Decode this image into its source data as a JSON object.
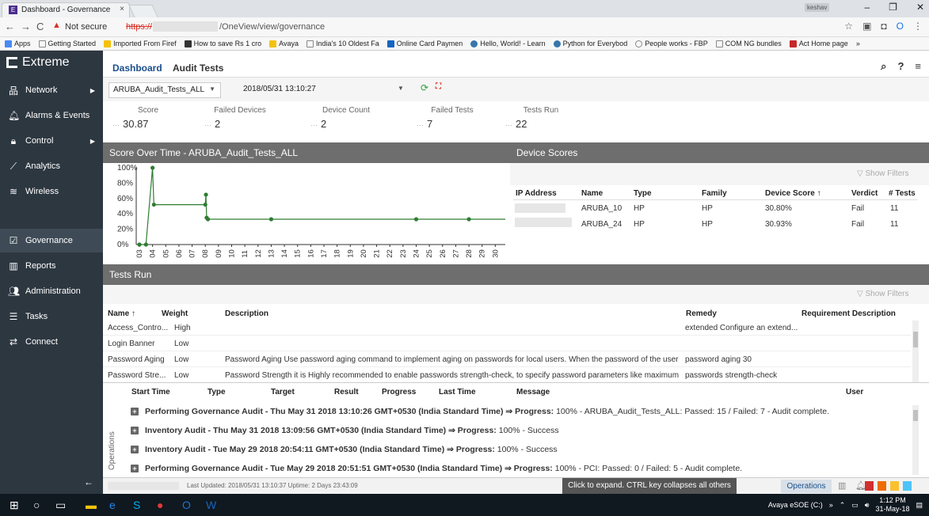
{
  "browser": {
    "tab_title": "Dashboard - Governance",
    "tab_close": "×",
    "not_secure": "Not secure",
    "https": "https://",
    "url_path": "/OneView/view/governance",
    "user_badge": "keshav",
    "bookmarks": [
      "Apps",
      "Getting Started",
      "Imported From Firef",
      "How to save Rs 1 cro",
      "Avaya",
      "India's 10 Oldest Fa",
      "Online Card Paymen",
      "Hello, World! - Learn",
      "Python for Everybod",
      "People works - FBP",
      "COM NG bundles",
      "Act Home page",
      "»"
    ]
  },
  "sidebar": {
    "brand": "Extreme",
    "items": [
      {
        "label": "Network",
        "icon": "network-icon"
      },
      {
        "label": "Alarms & Events",
        "icon": "bell-icon"
      },
      {
        "label": "Control",
        "icon": "lock-icon"
      },
      {
        "label": "Analytics",
        "icon": "chart-line-icon"
      },
      {
        "label": "Wireless",
        "icon": "wifi-icon"
      },
      {
        "label": "Governance",
        "icon": "check-square-icon"
      },
      {
        "label": "Reports",
        "icon": "bar-chart-icon"
      },
      {
        "label": "Administration",
        "icon": "users-icon"
      },
      {
        "label": "Tasks",
        "icon": "tasks-icon"
      },
      {
        "label": "Connect",
        "icon": "arrows-icon"
      }
    ]
  },
  "topnav": {
    "dashboard": "Dashboard",
    "audit_tests": "Audit Tests"
  },
  "selectors": {
    "test_suite": "ARUBA_Audit_Tests_ALL",
    "run_time": "2018/05/31 13:10:27"
  },
  "stats": [
    {
      "label": "Score",
      "value": "30.87"
    },
    {
      "label": "Failed Devices",
      "value": "2"
    },
    {
      "label": "Device Count",
      "value": "2"
    },
    {
      "label": "Failed Tests",
      "value": "7"
    },
    {
      "label": "Tests Run",
      "value": "22"
    }
  ],
  "score_panel": {
    "title": "Score Over Time - ARUBA_Audit_Tests_ALL"
  },
  "chart_data": {
    "type": "line",
    "title": "Score Over Time - ARUBA_Audit_Tests_ALL",
    "ylim": [
      0,
      100
    ],
    "y_ticks": [
      "100%",
      "80%",
      "60%",
      "40%",
      "20%",
      "0%"
    ],
    "categories": [
      "05/03",
      "05/04",
      "05/05",
      "05/06",
      "05/07",
      "05/08",
      "05/09",
      "05/10",
      "05/11",
      "05/12",
      "05/13",
      "05/14",
      "05/15",
      "05/16",
      "05/17",
      "05/18",
      "05/19",
      "05/20",
      "05/21",
      "05/22",
      "05/23",
      "05/24",
      "05/25",
      "05/26",
      "05/27",
      "05/28",
      "05/29",
      "05/30"
    ],
    "x": [
      0,
      0.5,
      1,
      1.1,
      5,
      5.05,
      5.1,
      5.2,
      10,
      21,
      25
    ],
    "y": [
      0,
      0,
      100,
      52,
      52,
      65,
      35,
      33,
      33,
      33,
      33
    ],
    "grid": false
  },
  "device_panel": {
    "title": "Device Scores",
    "show_filters": "Show Filters",
    "columns": [
      "IP Address",
      "Name",
      "Type",
      "Family",
      "Device Score ↑",
      "Verdict",
      "# Tests"
    ],
    "rows": [
      {
        "name": "ARUBA_10",
        "type": "HP",
        "family": "HP",
        "score": "30.80%",
        "verdict": "Fail",
        "tests": "11"
      },
      {
        "name": "ARUBA_24",
        "type": "HP",
        "family": "HP",
        "score": "30.93%",
        "verdict": "Fail",
        "tests": "11"
      }
    ]
  },
  "tests_panel": {
    "title": "Tests Run",
    "show_filters": "Show Filters",
    "columns": [
      "Name ↑",
      "Weight",
      "Description",
      "Remedy",
      "Requirement Description"
    ],
    "rows": [
      {
        "name": "Access_Contro...",
        "weight": "High",
        "description": "",
        "remedy": "extended Configure an extend..."
      },
      {
        "name": "Login Banner",
        "weight": "Low",
        "description": "",
        "remedy": ""
      },
      {
        "name": "Password Aging",
        "weight": "Low",
        "description": "Password Aging Use password aging command to implement aging on passwords for local users. When the password of the user expir...",
        "remedy": "password aging 30"
      },
      {
        "name": "Password Stre...",
        "weight": "Low",
        "description": "Password Strength it is Highly recommended to enable passwords strength-check, to specify password parameters like maximum cons...",
        "remedy": "passwords strength-check"
      }
    ]
  },
  "operations": {
    "label": "Operations",
    "columns": [
      "Start Time",
      "Type",
      "Target",
      "Result",
      "Progress",
      "Last Time",
      "Message",
      "User"
    ],
    "rows": [
      {
        "bold": "Performing Governance Audit - Thu May 31 2018 13:10:26 GMT+0530 (India Standard Time) ⇒ Progress:",
        "rest": " 100% - ARUBA_Audit_Tests_ALL: Passed: 15 / Failed: 7 - Audit complete."
      },
      {
        "bold": "Inventory Audit - Thu May 31 2018 13:09:56 GMT+0530 (India Standard Time) ⇒ Progress:",
        "rest": " 100% - Success"
      },
      {
        "bold": "Inventory Audit - Tue May 29 2018 20:54:11 GMT+0530 (India Standard Time) ⇒ Progress:",
        "rest": " 100% - Success"
      },
      {
        "bold": "Performing Governance Audit - Tue May 29 2018 20:51:51 GMT+0530 (India Standard Time) ⇒ Progress:",
        "rest": " 100% - PCI: Passed: 0 / Failed: 5 - Audit complete."
      }
    ]
  },
  "status": {
    "last_updated": "Last Updated: 2018/05/31 13:10:37  Uptime: 2 Days 23:43:09",
    "tooltip": "Click to expand. CTRL key collapses all others",
    "ops_button": "Operations"
  },
  "taskbar": {
    "tray_text": "Avaya eSOE (C:)",
    "time": "1:12 PM",
    "date": "31-May-18"
  },
  "colors": {
    "accent": "#1a4f8b",
    "sidebar": "#2d3740",
    "panel_header": "#6e6e6e",
    "series": "#2e7d32"
  }
}
